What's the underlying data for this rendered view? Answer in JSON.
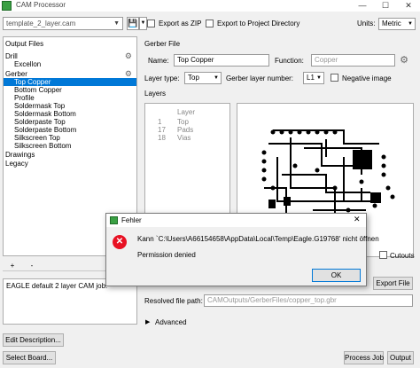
{
  "window": {
    "title": "CAM Processor",
    "controls": [
      "—",
      "☐",
      "✕"
    ]
  },
  "toolbar": {
    "job_file": "template_2_layer.cam",
    "export_zip_label": "Export as ZIP",
    "export_project_label": "Export to Project Directory",
    "units_label": "Units:",
    "units_value": "Metric"
  },
  "tree": {
    "items": [
      {
        "label": "Output Files",
        "indent": 0
      },
      {
        "label": "Drill",
        "indent": 0,
        "gear": true
      },
      {
        "label": "Excellon",
        "indent": 1
      },
      {
        "label": "Gerber",
        "indent": 0,
        "gear": true
      },
      {
        "label": "Top Copper",
        "indent": 1,
        "selected": true
      },
      {
        "label": "Bottom Copper",
        "indent": 1
      },
      {
        "label": "Profile",
        "indent": 1
      },
      {
        "label": "Soldermask Top",
        "indent": 1
      },
      {
        "label": "Soldermask Bottom",
        "indent": 1
      },
      {
        "label": "Solderpaste Top",
        "indent": 1
      },
      {
        "label": "Solderpaste Bottom",
        "indent": 1
      },
      {
        "label": "Silkscreen Top",
        "indent": 1
      },
      {
        "label": "Silkscreen Bottom",
        "indent": 1
      },
      {
        "label": "Drawings",
        "indent": 0
      },
      {
        "label": "Legacy",
        "indent": 0
      }
    ],
    "add_label": "+",
    "remove_label": "-"
  },
  "description": "EAGLE default 2 layer CAM job.",
  "buttons": {
    "edit_description": "Edit Description...",
    "select_board": "Select Board...",
    "process_job": "Process Job",
    "output": "Output",
    "export_file": "Export File"
  },
  "gerber": {
    "group_label": "Gerber File",
    "name_label": "Name:",
    "name_value": "Top Copper",
    "function_label": "Function:",
    "function_value": "Copper",
    "layer_type_label": "Layer type:",
    "layer_type_value": "Top",
    "layer_number_label": "Gerber layer number:",
    "layer_number_value": "L1",
    "negative_label": "Negative image"
  },
  "layers": {
    "group_label": "Layers",
    "header": [
      "Layer"
    ],
    "rows": [
      {
        "num": "1",
        "name": "Top"
      },
      {
        "num": "17",
        "name": "Pads"
      },
      {
        "num": "18",
        "name": "Vias"
      }
    ]
  },
  "cutouts_label": "Cutouts",
  "resolved": {
    "label": "Resolved file path:",
    "value": "CAMOutputs/GerberFiles/copper_top.gbr"
  },
  "advanced_label": "Advanced",
  "dialog": {
    "title": "Fehler",
    "message": "Kann `C:\\Users\\A66154658\\AppData\\Local\\Temp\\Eagle.G19768' nicht öffnen",
    "detail": "Permission denied",
    "ok_label": "OK",
    "close_label": "✕"
  },
  "colors": {
    "selection": "#0078d7",
    "error_red": "#e81123",
    "ok_border": "#0078d7"
  }
}
